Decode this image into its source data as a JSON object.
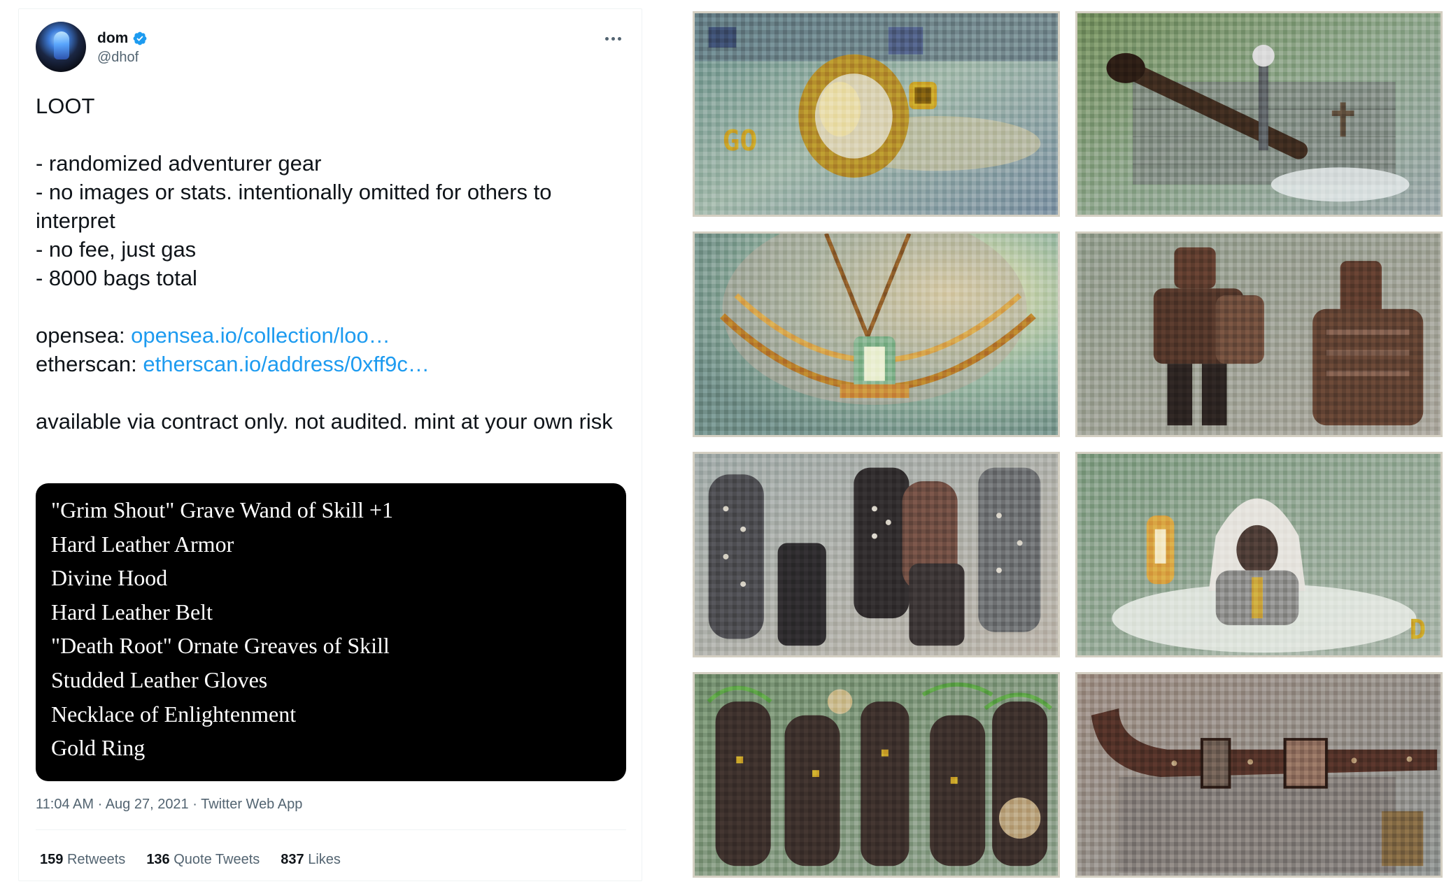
{
  "tweet": {
    "display_name": "dom",
    "handle": "@dhof",
    "title": "LOOT",
    "bullets": [
      "- randomized adventurer gear",
      "- no images or stats. intentionally omitted for others to interpret",
      "- no fee, just gas",
      "- 8000 bags total"
    ],
    "opensea_label": "opensea: ",
    "opensea_link": "opensea.io/collection/loo…",
    "etherscan_label": "etherscan: ",
    "etherscan_link": "etherscan.io/address/0xff9c…",
    "disclaimer": "available via contract only. not audited. mint at your own risk",
    "loot_items": [
      "\"Grim Shout\" Grave Wand of Skill +1",
      "Hard Leather Armor",
      "Divine Hood",
      "Hard Leather Belt",
      "\"Death Root\" Ornate Greaves of Skill",
      "Studded Leather Gloves",
      "Necklace of Enlightenment",
      "Gold Ring"
    ],
    "meta": "11:04 AM · Aug 27, 2021 · Twitter Web App",
    "stats": {
      "retweets_count": "159",
      "retweets_label": "Retweets",
      "quotes_count": "136",
      "quotes_label": "Quote Tweets",
      "likes_count": "837",
      "likes_label": "Likes"
    }
  },
  "images": [
    {
      "subject": "gold-ring"
    },
    {
      "subject": "grave-wand"
    },
    {
      "subject": "necklace"
    },
    {
      "subject": "hard-leather-armor"
    },
    {
      "subject": "studded-leather-gloves"
    },
    {
      "subject": "divine-hood"
    },
    {
      "subject": "ornate-greaves"
    },
    {
      "subject": "hard-leather-belt"
    }
  ],
  "colors": {
    "link": "#1d9bf0",
    "verified": "#1d9bf0",
    "secondary_text": "#536471"
  }
}
